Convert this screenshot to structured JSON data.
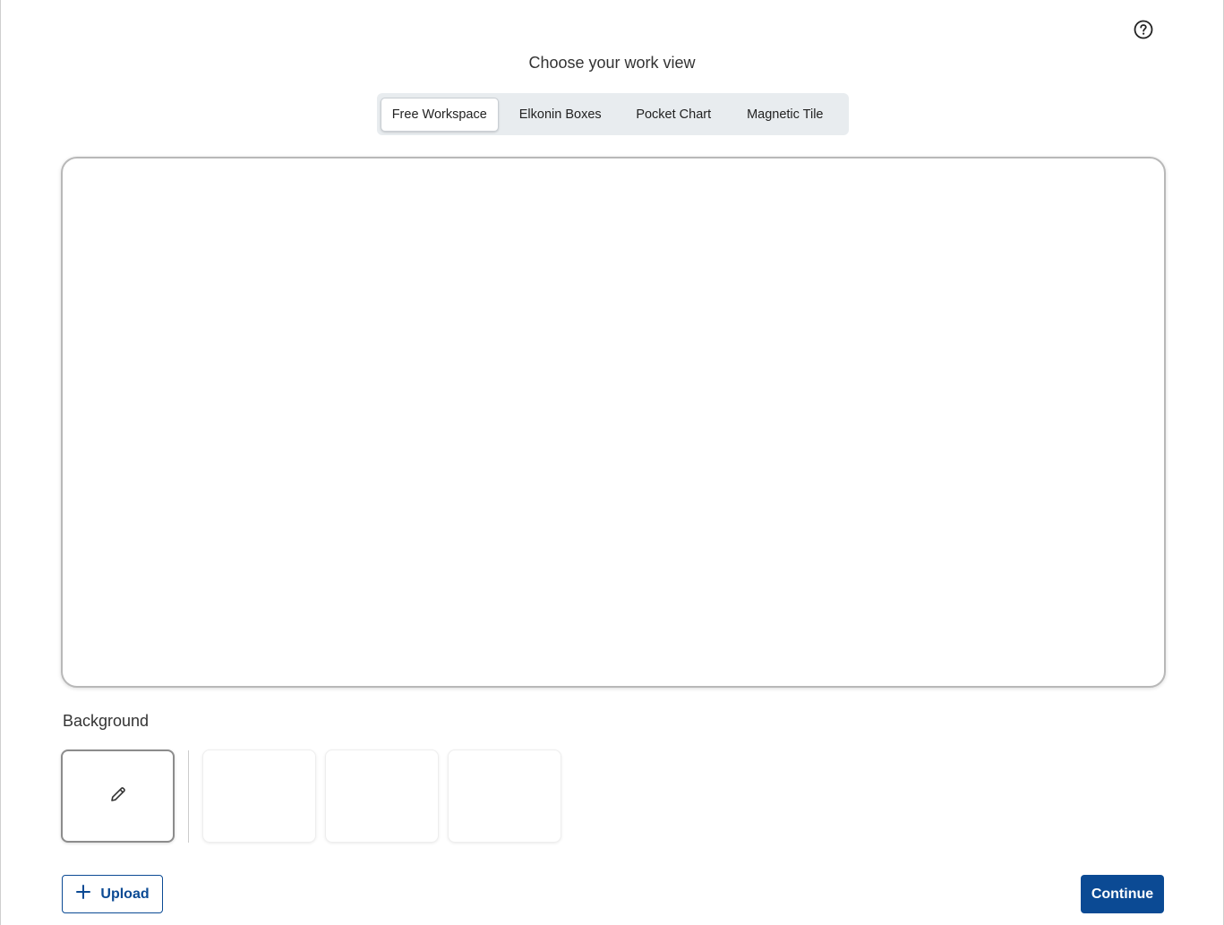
{
  "header": {
    "title": "Choose your work view",
    "help_icon": "help-circle-icon"
  },
  "tabs": [
    {
      "label": "Free Workspace",
      "active": true
    },
    {
      "label": "Elkonin Boxes",
      "active": false
    },
    {
      "label": "Pocket Chart",
      "active": false
    },
    {
      "label": "Magnetic Tile",
      "active": false
    }
  ],
  "background": {
    "label": "Background",
    "selected_icon": "pencil-icon"
  },
  "actions": {
    "upload_label": "Upload",
    "upload_icon": "plus-icon",
    "continue_label": "Continue"
  },
  "colors": {
    "primary": "#0b4a94",
    "tab_track": "#e8ecef",
    "workspace_border": "#b8b8b8"
  }
}
